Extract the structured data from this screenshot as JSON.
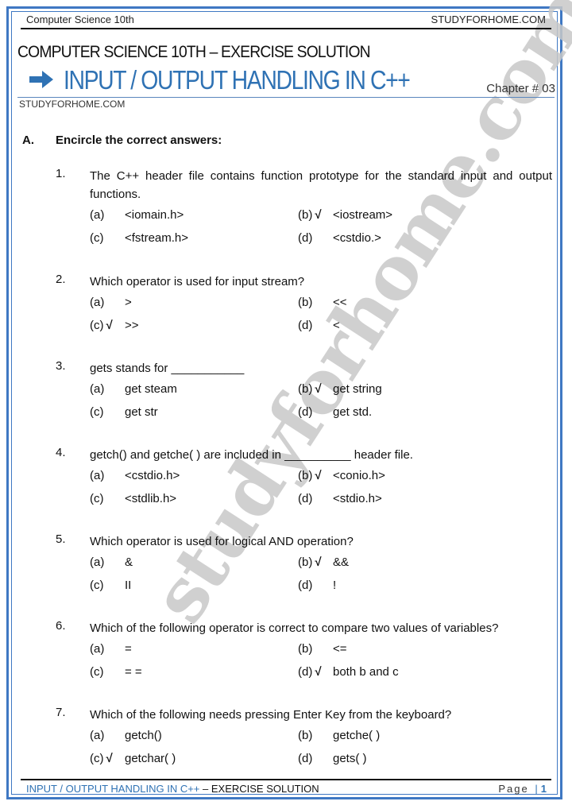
{
  "header": {
    "subject": "Computer Science 10th",
    "site": "STUDYFORHOME.COM",
    "title": "COMPUTER SCIENCE 10TH – EXERCISE SOLUTION",
    "chapter_title": "INPUT / OUTPUT HANDLING IN C++",
    "chapter_no": "Chapter # 03",
    "site_small": "STUDYFORHOME.COM",
    "arrow_icon": "right-arrow-icon"
  },
  "section": {
    "letter": "A.",
    "title": "Encircle the correct answers:"
  },
  "questions": [
    {
      "num": "1.",
      "text": "The C++ header file contains function prototype for the standard input and output functions.",
      "options": [
        {
          "label": "(a)",
          "value": "<iomain.h>",
          "correct": false
        },
        {
          "label": "(b)",
          "value": "<iostream>",
          "correct": true
        },
        {
          "label": "(c)",
          "value": "<fstream.h>",
          "correct": false
        },
        {
          "label": "(d)",
          "value": "<cstdio.>",
          "correct": false
        }
      ]
    },
    {
      "num": "2.",
      "text": "Which operator is used for input stream?",
      "options": [
        {
          "label": "(a)",
          "value": ">",
          "correct": false
        },
        {
          "label": "(b)",
          "value": "<<",
          "correct": false
        },
        {
          "label": "(c)",
          "value": ">>",
          "correct": true
        },
        {
          "label": "(d)",
          "value": "<",
          "correct": false
        }
      ]
    },
    {
      "num": "3.",
      "text": "gets stands for ___________",
      "options": [
        {
          "label": "(a)",
          "value": "get steam",
          "correct": false
        },
        {
          "label": "(b)",
          "value": "get string",
          "correct": true
        },
        {
          "label": "(c)",
          "value": "get str",
          "correct": false
        },
        {
          "label": "(d)",
          "value": "get std.",
          "correct": false
        }
      ]
    },
    {
      "num": "4.",
      "text": "getch() and getche( ) are included in __________ header file.",
      "options": [
        {
          "label": "(a)",
          "value": "<cstdio.h>",
          "correct": false
        },
        {
          "label": "(b)",
          "value": "<conio.h>",
          "correct": true
        },
        {
          "label": "(c)",
          "value": "<stdlib.h>",
          "correct": false
        },
        {
          "label": "(d)",
          "value": "<stdio.h>",
          "correct": false
        }
      ]
    },
    {
      "num": "5.",
      "text": "Which operator is used for logical AND operation?",
      "options": [
        {
          "label": "(a)",
          "value": "&",
          "correct": false
        },
        {
          "label": "(b)",
          "value": "&&",
          "correct": true
        },
        {
          "label": "(c)",
          "value": "II",
          "correct": false
        },
        {
          "label": "(d)",
          "value": "!",
          "correct": false
        }
      ]
    },
    {
      "num": "6.",
      "text": "Which of the following operator is correct to compare two values of variables?",
      "options": [
        {
          "label": "(a)",
          "value": "=",
          "correct": false
        },
        {
          "label": "(b)",
          "value": "<=",
          "correct": false
        },
        {
          "label": "(c)",
          "value": "= =",
          "correct": false
        },
        {
          "label": "(d)",
          "value": "both b and c",
          "correct": true
        }
      ]
    },
    {
      "num": "7.",
      "text": "Which of the following needs pressing Enter Key from the keyboard?",
      "options": [
        {
          "label": "(a)",
          "value": "getch()",
          "correct": false
        },
        {
          "label": "(b)",
          "value": "getche( )",
          "correct": false
        },
        {
          "label": "(c)",
          "value": "getchar( )",
          "correct": true
        },
        {
          "label": "(d)",
          "value": "gets( )",
          "correct": false
        }
      ]
    }
  ],
  "tick_mark": "√",
  "footer": {
    "chapter": "INPUT / OUTPUT HANDLING IN C++",
    "suffix": " – EXERCISE SOLUTION",
    "page_label": "Page",
    "page_sep": "|",
    "page_number": "1"
  },
  "watermark": "studyforhome.com",
  "colors": {
    "accent": "#2f72b4",
    "frame": "#3f78c3",
    "watermark": "#c8c8c8"
  }
}
